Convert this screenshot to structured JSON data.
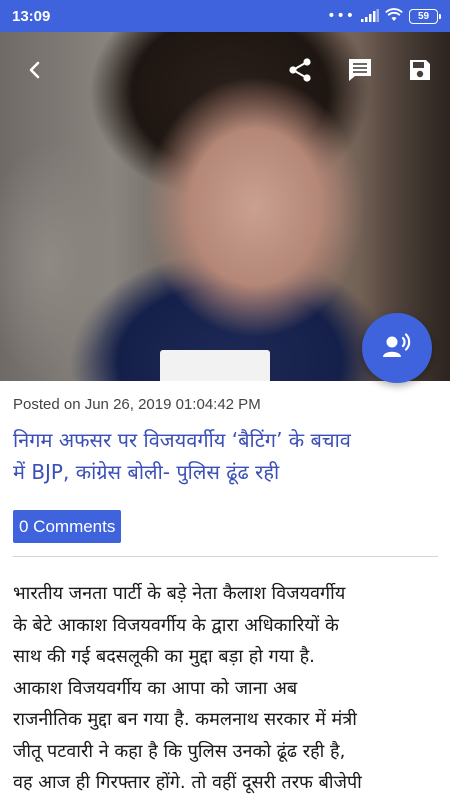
{
  "status_bar": {
    "time": "13:09",
    "dots": "•••",
    "battery": "59",
    "icons": [
      "signal-icon",
      "wifi-icon",
      "battery-icon"
    ]
  },
  "toolbar": {
    "icons": [
      "back-arrow-icon",
      "share-icon",
      "comment-icon",
      "save-icon"
    ]
  },
  "fab": {
    "icon": "speaker-icon",
    "color": "#3f63dd"
  },
  "article": {
    "posted": "Posted on Jun 26, 2019 01:04:42 PM",
    "title_lines": [
      "निगम अफसर पर विजयवर्गीय ‘बैटिंग’ के बचाव",
      "में BJP, कांग्रेस बोली- पुलिस ढूंढ रही"
    ],
    "comments_label": "0 Comments",
    "body_lines": [
      "भारतीय जनता पार्टी के बड़े नेता कैलाश विजयवर्गीय",
      "के बेटे आकाश विजयवर्गीय के द्वारा अधिकारियों के",
      "साथ की गई बदसलूकी का मुद्दा बड़ा हो गया है.",
      "आकाश विजयवर्गीय का आपा को जाना अब",
      "राजनीतिक मुद्दा बन गया है. कमलनाथ सरकार में मंत्री",
      "जीतू पटवारी ने कहा है कि पुलिस उनको ढूंढ रही है,",
      "वह आज ही गिरफ्तार होंगे. तो वहीं दूसरी तरफ बीजेपी"
    ]
  },
  "colors": {
    "accent": "#3f63dd",
    "title": "#3a4fb8"
  }
}
